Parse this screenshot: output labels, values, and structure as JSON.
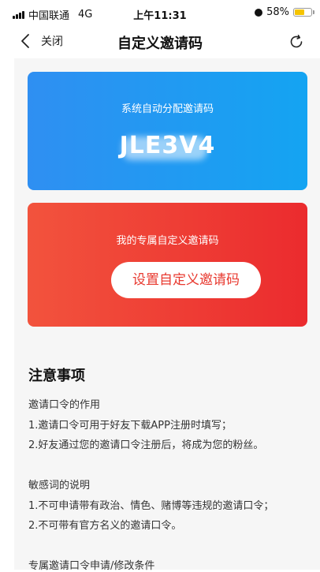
{
  "status_bar": {
    "carrier": "中国联通",
    "network": "4G",
    "time": "上午11:31",
    "battery_percent": "58%",
    "battery_level": 0.58
  },
  "nav": {
    "back_label": "关闭",
    "title": "自定义邀请码",
    "back_icon": "chevron-left-icon",
    "refresh_icon": "refresh-icon"
  },
  "auto_card": {
    "label": "系统自动分配邀请码",
    "code": "JLE3V4",
    "color_start": "#2f8ff2",
    "color_end": "#14a4f2"
  },
  "custom_card": {
    "label": "我的专属自定义邀请码",
    "button_label": "设置自定义邀请码",
    "color_start": "#f2533d",
    "color_end": "#eb2b2e"
  },
  "notes": {
    "title": "注意事项",
    "lines": [
      "邀请口令的作用",
      "1.邀请口令可用于好友下载APP注册时填写；",
      "2.好友通过您的邀请口令注册后，将成为您的粉丝。",
      "敏感词的说明",
      "1.不可申请带有政治、情色、赌博等违规的邀请口令；",
      "2.不可带有官方名义的邀请口令。",
      "专属邀请口令申请/修改条件"
    ]
  }
}
